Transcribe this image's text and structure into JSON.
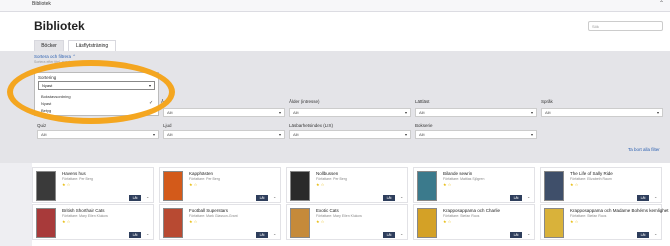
{
  "window": {
    "title": "Bibliotek",
    "collapse_icon": "chevron-up-icon"
  },
  "header": {
    "title": "Bibliotek",
    "search_placeholder": "Sök"
  },
  "tabs": [
    {
      "label": "Böcker",
      "active": true
    },
    {
      "label": "Läsflytsträning",
      "active": false
    }
  ],
  "filters": {
    "sort_link": "Sortera och filtrera ⌃",
    "sort_sub": "Sortera efter titel, nyaste och betyg",
    "sort": {
      "label": "Sortering",
      "value": "Nyast",
      "options": [
        {
          "label": "Bokstavsordning",
          "selected": false
        },
        {
          "label": "Nyast",
          "selected": true
        },
        {
          "label": "Betyg",
          "selected": false
        }
      ]
    },
    "row1": [
      {
        "label": "Å",
        "value": "Allt"
      },
      {
        "label": "Ålder (intresse)",
        "value": "Allt"
      },
      {
        "label": "Lättläst",
        "value": "Allt"
      },
      {
        "label": "Språk",
        "value": "Allt"
      }
    ],
    "row2": [
      {
        "label": "Quiz",
        "value": "Allt"
      },
      {
        "label": "Ljud",
        "value": "Allt"
      },
      {
        "label": "Läsbarhetsindex (LIX)",
        "value": "Allt"
      },
      {
        "label": "Bokserie",
        "value": "Allt"
      }
    ],
    "clear_link": "Ta bort alla filter"
  },
  "books": [
    {
      "title": "Havens hus",
      "author": "Författare: Per Berg",
      "button": "Låt",
      "cover": "#3a3a3a"
    },
    {
      "title": "Kapphästen",
      "author": "Författare: Per Berg",
      "button": "Låt",
      "cover": "#d35a1a"
    },
    {
      "title": "Nollbussen",
      "author": "Författare: Per Berg",
      "button": "Låt",
      "cover": "#2a2a2a"
    },
    {
      "title": "Bilande sewrin",
      "author": "Författare: Mattias Sjögren",
      "button": "Låt",
      "cover": "#3b7a8c"
    },
    {
      "title": "The Life of Sally Ride",
      "author": "Författare: Elizabeth Raum",
      "button": "Låt",
      "cover": "#3f4f6a"
    },
    {
      "title": "British Shorthair Cats",
      "author": "Författare: Mary Ellen Klukow",
      "button": "Låt",
      "cover": "#a83a3a"
    },
    {
      "title": "Football Superstars",
      "author": "Författare: Mark Glasson-Grant",
      "button": "Låt",
      "cover": "#b84a32"
    },
    {
      "title": "Exotic Cats",
      "author": "Författare: Mary Ellen Klukow",
      "button": "Låt",
      "cover": "#c58a3a"
    },
    {
      "title": "Krapposappama och Charlie",
      "author": "Författare: Stefan Roos",
      "button": "Låt",
      "cover": "#d4a126"
    },
    {
      "title": "Krapposappama och Madame Bohéms kemlighet",
      "author": "Författare: Stefan Roos",
      "button": "Låt",
      "cover": "#d9b23a"
    }
  ]
}
